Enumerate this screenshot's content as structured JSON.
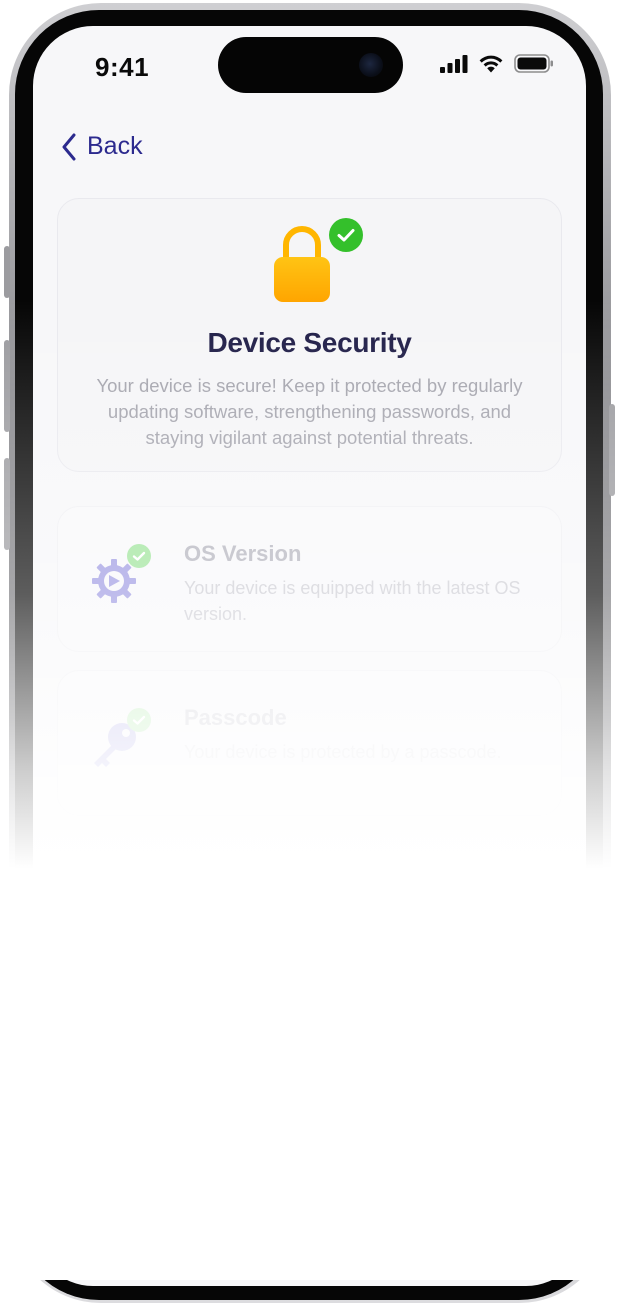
{
  "status_bar": {
    "time": "9:41"
  },
  "nav": {
    "back_label": "Back"
  },
  "security": {
    "title": "Device Security",
    "description": "Your device is secure! Keep it protected by regularly updating software, strengthening passwords, and staying vigilant against potential threats."
  },
  "checks": [
    {
      "title": "OS Version",
      "description": "Your device is equipped with the latest OS version.",
      "icon": "gear-icon"
    },
    {
      "title": "Passcode",
      "description": "Your device is protected by a passcode.",
      "icon": "key-icon"
    }
  ],
  "colors": {
    "accent": "#2c2a8e",
    "success": "#34c02b",
    "lock": "#ffb300",
    "title": "#1d1b45"
  }
}
